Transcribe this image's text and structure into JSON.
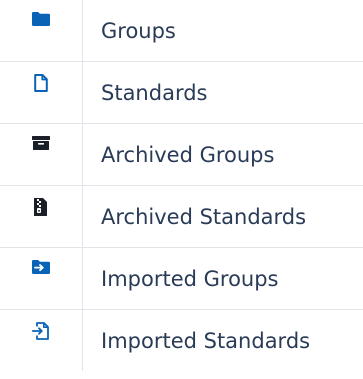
{
  "legend": {
    "rows": [
      {
        "icon": "folder-icon",
        "label": "Groups",
        "color": "#0b63b6"
      },
      {
        "icon": "document-icon",
        "label": "Standards",
        "color": "#0b63b6"
      },
      {
        "icon": "archive-box-icon",
        "label": "Archived Groups",
        "color": "#1b1f27"
      },
      {
        "icon": "archive-file-icon",
        "label": "Archived Standards",
        "color": "#1b1f27"
      },
      {
        "icon": "import-folder-icon",
        "label": "Imported Groups",
        "color": "#0b63b6"
      },
      {
        "icon": "import-file-icon",
        "label": "Imported Standards",
        "color": "#0b63b6"
      }
    ]
  }
}
